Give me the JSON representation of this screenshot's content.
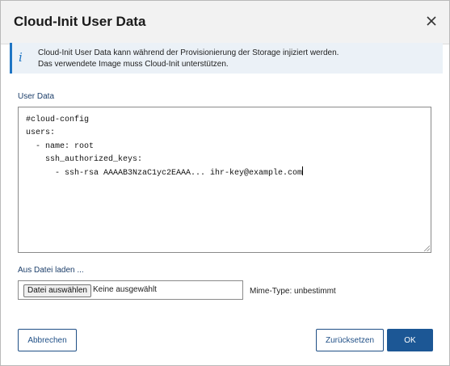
{
  "dialog": {
    "title": "Cloud-Init User Data",
    "close_icon": "close-icon"
  },
  "info": {
    "icon": "info-icon",
    "icon_glyph": "i",
    "line1": "Cloud-Init User Data kann während der Provisionierung der Storage injiziert werden.",
    "line2": "Das verwendete Image muss Cloud-Init unterstützen."
  },
  "user_data": {
    "label": "User Data",
    "lines": [
      "#cloud-config",
      "users:",
      "  - name: root",
      "    ssh_authorized_keys:",
      "      - ssh-rsa AAAAB3NzaC1yc2EAAA... ihr-key@example.com"
    ]
  },
  "file_upload": {
    "label": "Aus Datei laden ...",
    "button_label": "Datei auswählen",
    "status": "Keine ausgewählt",
    "mime_type": "Mime-Type: unbestimmt"
  },
  "buttons": {
    "cancel": "Abbrechen",
    "reset": "Zurücksetzen",
    "ok": "OK"
  },
  "colors": {
    "accent": "#1f75c4",
    "primary_button": "#1c5795",
    "header_bg": "#f2f2f2",
    "info_bg": "#ebf1f7"
  }
}
